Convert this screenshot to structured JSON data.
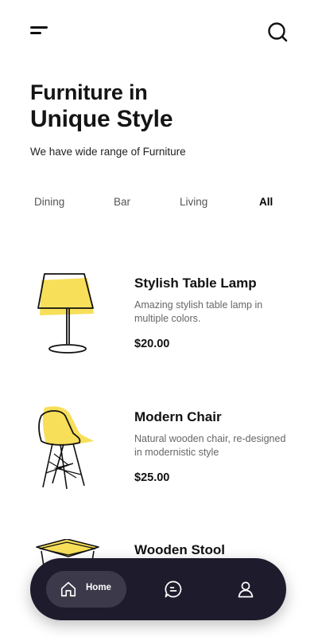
{
  "header": {
    "menu_icon": "menu-icon",
    "search_icon": "search-icon"
  },
  "hero": {
    "title_line1": "Furniture in",
    "title_line2": "Unique Style",
    "subtitle": "We have wide range of Furniture"
  },
  "categories": [
    {
      "label": "Dining",
      "active": false
    },
    {
      "label": "Bar",
      "active": false
    },
    {
      "label": "Living",
      "active": false
    },
    {
      "label": "All",
      "active": true
    }
  ],
  "products": [
    {
      "name": "Stylish Table Lamp",
      "description": "Amazing stylish table lamp in multiple colors.",
      "price": "$20.00",
      "image_icon": "table-lamp-icon"
    },
    {
      "name": "Modern Chair",
      "description": "Natural wooden chair, re-designed in modernistic style",
      "price": "$25.00",
      "image_icon": "chair-icon"
    },
    {
      "name": "Wooden Stool",
      "description": "",
      "price": "",
      "image_icon": "stool-icon"
    }
  ],
  "bottom_nav": {
    "home_label": "Home",
    "items": [
      "home-icon",
      "chat-icon",
      "profile-icon"
    ]
  },
  "colors": {
    "accent_yellow": "#f7df5a",
    "nav_background": "#1d1b2c",
    "nav_active_pill": "#3c3a4a"
  }
}
